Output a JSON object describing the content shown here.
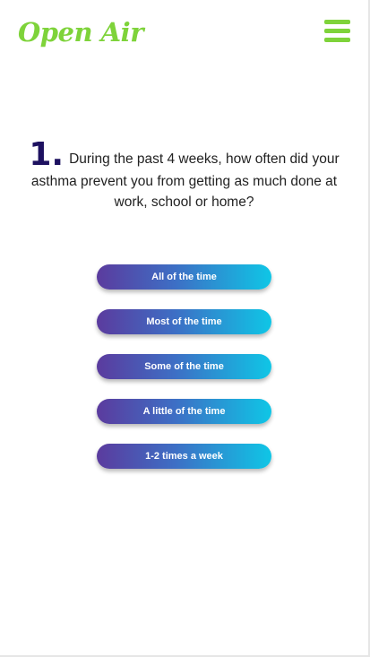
{
  "header": {
    "logo_text": "Open Air",
    "menu_icon": "hamburger-menu-icon",
    "brand_color": "#7ed33a"
  },
  "question": {
    "number": "1.",
    "text": "During the past 4 weeks, how often did your asthma prevent you from getting as much done at work, school or home?"
  },
  "answers": [
    {
      "label": "All of the time"
    },
    {
      "label": "Most of the time"
    },
    {
      "label": "Some of the time"
    },
    {
      "label": "A little of the time"
    },
    {
      "label": "1-2 times a week"
    }
  ],
  "colors": {
    "number_color": "#1d1160",
    "button_gradient_start": "#5b3b9e",
    "button_gradient_end": "#0fc6e6"
  }
}
